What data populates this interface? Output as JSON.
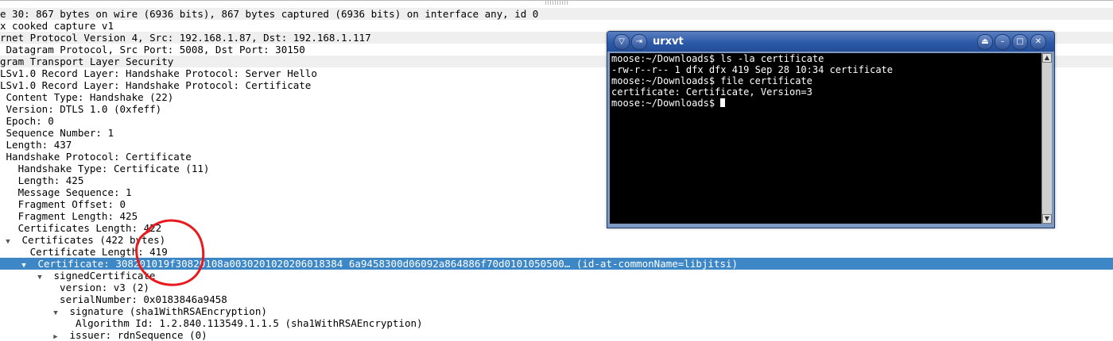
{
  "packet_details": {
    "rows": [
      {
        "indent": 0,
        "twisty": "",
        "text": "e 30: 867 bytes on wire (6936 bits), 867 bytes captured (6936 bits) on interface any, id 0",
        "shade": true
      },
      {
        "indent": 0,
        "twisty": "",
        "text": "x cooked capture v1",
        "shade": false
      },
      {
        "indent": 0,
        "twisty": "",
        "text": "rnet Protocol Version 4, Src: 192.168.1.87, Dst: 192.168.1.117",
        "shade": true
      },
      {
        "indent": 0,
        "twisty": "",
        "text": " Datagram Protocol, Src Port: 5008, Dst Port: 30150",
        "shade": false
      },
      {
        "indent": 0,
        "twisty": "",
        "text": "gram Transport Layer Security",
        "shade": true
      },
      {
        "indent": 0,
        "twisty": "",
        "text": "LSv1.0 Record Layer: Handshake Protocol: Server Hello",
        "shade": false
      },
      {
        "indent": 0,
        "twisty": "",
        "text": "LSv1.0 Record Layer: Handshake Protocol: Certificate",
        "shade": false
      },
      {
        "indent": 0,
        "twisty": "",
        "text": " Content Type: Handshake (22)",
        "shade": false
      },
      {
        "indent": 0,
        "twisty": "",
        "text": " Version: DTLS 1.0 (0xfeff)",
        "shade": false
      },
      {
        "indent": 0,
        "twisty": "",
        "text": " Epoch: 0",
        "shade": false
      },
      {
        "indent": 0,
        "twisty": "",
        "text": " Sequence Number: 1",
        "shade": false
      },
      {
        "indent": 0,
        "twisty": "",
        "text": " Length: 437",
        "shade": false
      },
      {
        "indent": 0,
        "twisty": "",
        "text": " Handshake Protocol: Certificate",
        "shade": false
      },
      {
        "indent": 0,
        "twisty": "",
        "text": "   Handshake Type: Certificate (11)",
        "shade": false
      },
      {
        "indent": 0,
        "twisty": "",
        "text": "   Length: 425",
        "shade": false
      },
      {
        "indent": 0,
        "twisty": "",
        "text": "   Message Sequence: 1",
        "shade": false
      },
      {
        "indent": 0,
        "twisty": "",
        "text": "   Fragment Offset: 0",
        "shade": false
      },
      {
        "indent": 0,
        "twisty": "",
        "text": "   Fragment Length: 425",
        "shade": false
      },
      {
        "indent": 0,
        "twisty": "",
        "text": "   Certificates Length: 422",
        "shade": false
      },
      {
        "indent": 0,
        "twisty": "▼",
        "text": " Certificates (422 bytes)",
        "shade": false
      },
      {
        "indent": 0,
        "twisty": "",
        "text": "     Certificate Length: 419",
        "shade": false
      },
      {
        "indent": 1,
        "twisty": "▼",
        "text": " Certificate: 308201019f30820108a0030201020206018384 6a9458300d06092a864886f70d0101050500… (id-at-commonName=libjitsi)",
        "shade": false,
        "selected": true
      },
      {
        "indent": 2,
        "twisty": "▼",
        "text": " signedCertificate",
        "shade": false
      },
      {
        "indent": 3,
        "twisty": "",
        "text": "  version: v3 (2)",
        "shade": false
      },
      {
        "indent": 3,
        "twisty": "",
        "text": "  serialNumber: 0x0183846a9458",
        "shade": false
      },
      {
        "indent": 3,
        "twisty": "▼",
        "text": " signature (sha1WithRSAEncryption)",
        "shade": false
      },
      {
        "indent": 4,
        "twisty": "",
        "text": "  Algorithm Id: 1.2.840.113549.1.1.5 (sha1WithRSAEncryption)",
        "shade": false
      },
      {
        "indent": 3,
        "twisty": "▶",
        "text": " issuer: rdnSequence (0)",
        "shade": false
      }
    ]
  },
  "selection_color": "#3d87c6",
  "annotation_color": "#e8191f",
  "terminal": {
    "title": "urxvt",
    "lines": [
      "moose:~/Downloads$ ls -la certificate",
      "-rw-r--r-- 1 dfx dfx 419 Sep 28 10:34 certificate",
      "moose:~/Downloads$ file certificate",
      "certificate: Certificate, Version=3",
      "moose:~/Downloads$ "
    ]
  }
}
